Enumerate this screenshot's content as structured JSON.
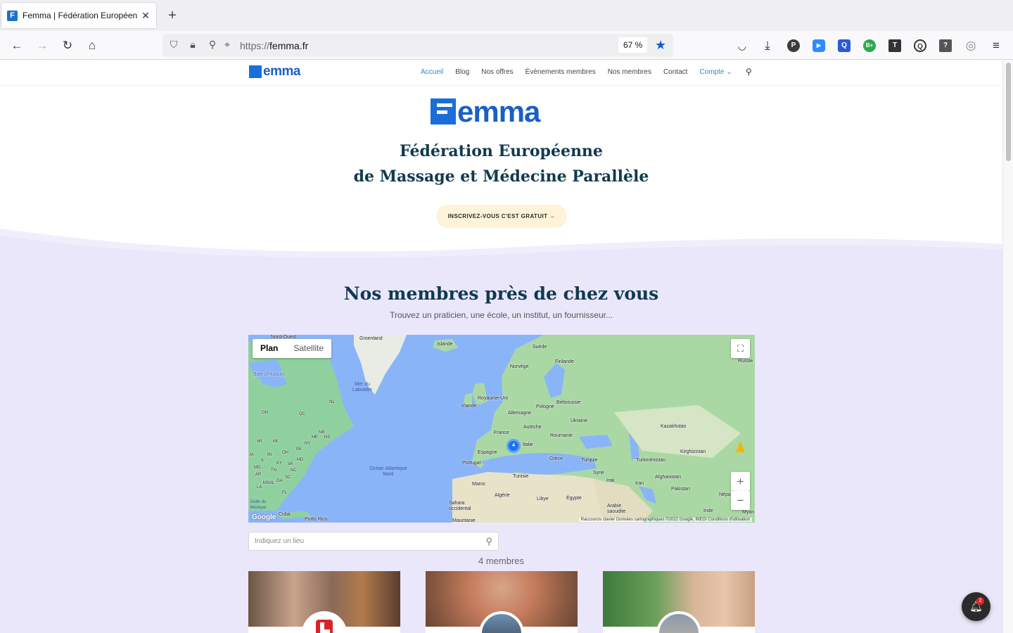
{
  "browser": {
    "tab_title": "Femma | Fédération Européenne",
    "close_glyph": "✕",
    "new_tab_glyph": "+",
    "url_protocol": "https://",
    "url_host": "femma.fr",
    "zoom": "67 %",
    "extensions": [
      {
        "name": "pocket-icon"
      },
      {
        "name": "download-icon"
      },
      {
        "name": "p-extension-icon",
        "label": "P",
        "color": "#3c3c3c"
      },
      {
        "name": "zoom-extension-icon",
        "label": "▶",
        "color": "#2d8cff"
      },
      {
        "name": "q-extension-icon",
        "label": "Q",
        "color": "#2b5bd7"
      },
      {
        "name": "bplus-extension-icon",
        "label": "B+",
        "color": "#2fa84f"
      },
      {
        "name": "t-extension-icon",
        "label": "T",
        "color": "#333333"
      },
      {
        "name": "lens-extension-icon",
        "label": "Q",
        "color": "#333333"
      },
      {
        "name": "help-extension-icon",
        "label": "?",
        "color": "#555555"
      },
      {
        "name": "account-icon"
      },
      {
        "name": "menu-icon"
      }
    ]
  },
  "site": {
    "logo_text": "emma",
    "nav": [
      "Accueil",
      "Blog",
      "Nos offres",
      "Évènements membres",
      "Nos membres",
      "Contact",
      "Compte"
    ],
    "active_nav": "Accueil",
    "hero_title_line1": "Fédération Européenne",
    "hero_title_line2": "de Massage et Médecine Parallèle",
    "cta_label": "INSCRIVEZ-VOUS C'EST GRATUIT →",
    "members_title": "Nos membres près de chez vous",
    "members_subtitle": "Trouvez un praticien, une école, un institut, un fournisseur...",
    "map": {
      "type_plan": "Plan",
      "type_satellite": "Satellite",
      "cluster_count": "4",
      "footer": "Raccourcis clavier   Données cartographiques ©2022 Google, INEGI   Conditions d'utilisation",
      "google": "Google",
      "labels": [
        "Groenland",
        "Nord-Ouest",
        "Islande",
        "Suède",
        "Finlande",
        "Norvège",
        "Russie",
        "Baie d'Hudson",
        "Mer du Labrador",
        "Royaume-Uni",
        "Irlande",
        "Biélorussie",
        "Pologne",
        "Allemagne",
        "Ukraine",
        "Kazakhstan",
        "France",
        "Autriche",
        "Roumanie",
        "Italie",
        "Espagne",
        "Portugal",
        "Grèce",
        "Turquie",
        "Turkménistan",
        "Kirghizistan",
        "Océan Atlantique Nord",
        "Tunisie",
        "Syrie",
        "Irak",
        "Iran",
        "Afghanistan",
        "Maroc",
        "Algérie",
        "Libye",
        "Égypte",
        "Pakistan",
        "Népal",
        "Inde",
        "Sahara occidental",
        "Arabie saoudite",
        "Cuba",
        "Porto Rico",
        "Golfe du Mexique",
        "Myan",
        "Mauritanie",
        "ON",
        "QC",
        "NL",
        "NB",
        "NS",
        "ME",
        "MI",
        "WI",
        "IN",
        "OH",
        "PA",
        "NY",
        "KY",
        "VA",
        "MD",
        "TN",
        "NC",
        "SC",
        "GA",
        "AL",
        "MS",
        "AR",
        "LA",
        "FL",
        "IL",
        "MO",
        "IA"
      ]
    },
    "place_placeholder": "Indiquez un lieu",
    "members_count": "4 membres",
    "notifications": "2"
  }
}
